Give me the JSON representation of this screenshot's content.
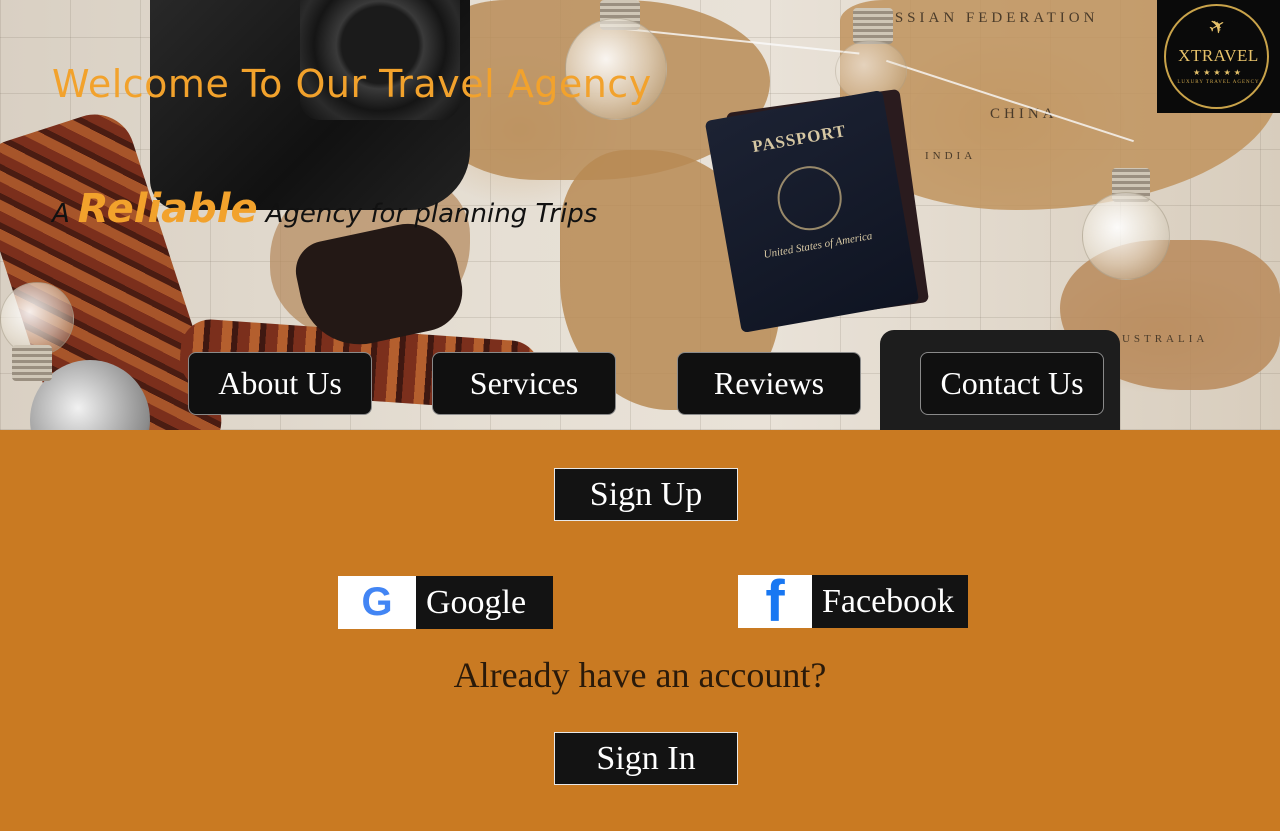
{
  "hero": {
    "welcome": "Welcome To Our Travel Agency",
    "tagline_prefix": "A",
    "tagline_highlight": "Reliable",
    "tagline_suffix": "Agency for planning Trips",
    "passport_title": "PASSPORT",
    "passport_sub": "United States of America",
    "map_labels": [
      "USSIAN FEDERATION",
      "CHINA",
      "INDIA",
      "AUSTRALIA"
    ]
  },
  "logo": {
    "name": "XTRAVEL",
    "stars": "★★★★★",
    "tagline": "LUXURY TRAVEL AGENCY"
  },
  "nav": {
    "about": "About Us",
    "services": "Services",
    "reviews": "Reviews",
    "contact": "Contact Us"
  },
  "auth": {
    "signup": "Sign Up",
    "google": "Google",
    "facebook": "Facebook",
    "already": "Already have an account?",
    "signin": "Sign In"
  },
  "icons": {
    "google": "google-icon",
    "facebook": "facebook-icon",
    "plane": "plane-icon"
  },
  "colors": {
    "accent": "#f2a22c",
    "background": "#c97a22",
    "button": "#131313",
    "facebook": "#1877f2"
  }
}
